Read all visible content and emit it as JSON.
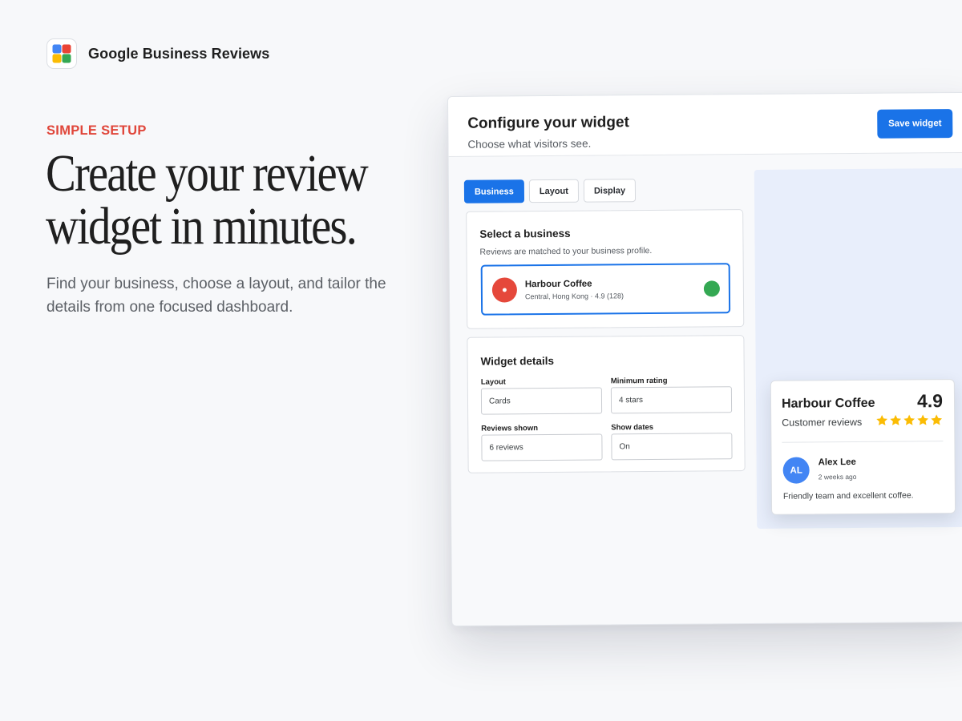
{
  "brand": {
    "name": "Google Business Reviews",
    "logo_icon": "four-color-tile-icon",
    "logo_colors": [
      "#ea4335",
      "#4285f4",
      "#fbbc04",
      "#34a853"
    ]
  },
  "hero": {
    "eyebrow": "SIMPLE SETUP",
    "headline_line1": "Create your review",
    "headline_line2": "widget in minutes.",
    "subcopy": "Find your business, choose a layout, and tailor the details from one focused dashboard."
  },
  "dashboard": {
    "title": "Configure your widget",
    "subtitle": "Choose what visitors see.",
    "save_label": "Save widget",
    "tabs": [
      {
        "label": "Business",
        "active": true
      },
      {
        "label": "Layout",
        "active": false
      },
      {
        "label": "Display",
        "active": false
      }
    ],
    "business_card": {
      "title": "Select a business",
      "hint": "Reviews are matched to your business profile.",
      "selected": {
        "name": "Harbour Coffee",
        "meta": "Central, Hong Kong · 4.9 (128)",
        "pin_icon": "location-pin-icon",
        "check_icon": "selected-check-icon"
      }
    },
    "details_card": {
      "title": "Widget details",
      "fields": {
        "layout": {
          "label": "Layout",
          "value": "Cards"
        },
        "minimum_rating": {
          "label": "Minimum rating",
          "value": "4 stars"
        },
        "reviews_shown": {
          "label": "Reviews shown",
          "value": "6 reviews"
        },
        "show_dates": {
          "label": "Show dates",
          "value": "On"
        }
      }
    },
    "preview": {
      "business_name": "Harbour Coffee",
      "rating": "4.9",
      "subtitle": "Customer reviews",
      "stars": 5,
      "star_color": "#fbbc04",
      "review": {
        "initials": "AL",
        "author": "Alex Lee",
        "time": "2 weeks ago",
        "text": "Friendly team and excellent coffee."
      }
    }
  },
  "colors": {
    "accent": "#1a73e8",
    "eyebrow": "#e0463a",
    "preview_background": "#e8eefb",
    "check": "#34a853",
    "pin": "#e5483b",
    "avatar": "#4285f4"
  }
}
